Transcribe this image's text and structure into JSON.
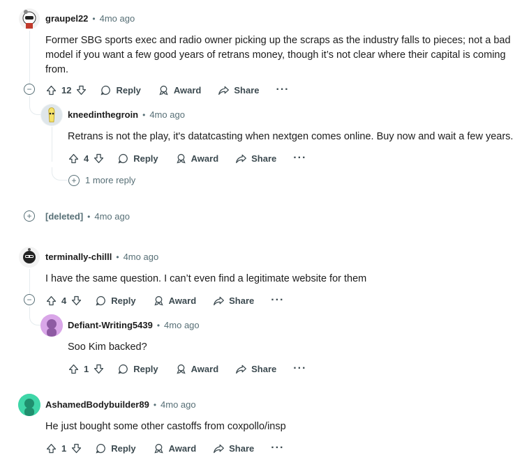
{
  "comments": [
    {
      "user": "graupel22",
      "time": "4mo ago",
      "lines": [
        "Former SBG sports exec and radio owner picking up the scraps as the industry falls to pieces; not a bad",
        "model if you want a few good years of retrans money, though it’s not clear where their capital is coming",
        "from."
      ],
      "votes": "12"
    },
    {
      "user": "kneedinthegroin",
      "time": "4mo ago",
      "lines": [
        "Retrans is not the play, it's datatcasting when nextgen comes online. Buy now and wait a few years."
      ],
      "votes": "4",
      "more_replies": "1 more reply"
    },
    {
      "user": "[deleted]",
      "time": "4mo ago"
    },
    {
      "user": "terminally-chilll",
      "time": "4mo ago",
      "lines": [
        "I have the same question. I can’t even find a legitimate website for them"
      ],
      "votes": "4"
    },
    {
      "user": "Defiant-Writing5439",
      "time": "4mo ago",
      "lines": [
        "Soo Kim backed?"
      ],
      "votes": "1"
    },
    {
      "user": "AshamedBodybuilder89",
      "time": "4mo ago",
      "lines": [
        "He just bought some other castoffs from coxpollo/insp"
      ],
      "votes": "1"
    }
  ],
  "actions": {
    "reply": "Reply",
    "award": "Award",
    "share": "Share",
    "more": "···",
    "separator": "•"
  },
  "colors": {
    "text": "#1c1c1c",
    "meta": "#576f76",
    "thread_line": "#e5ebee",
    "avatar_defiant": "#d9a6e8",
    "avatar_ashamed": "#3fd6a8"
  }
}
